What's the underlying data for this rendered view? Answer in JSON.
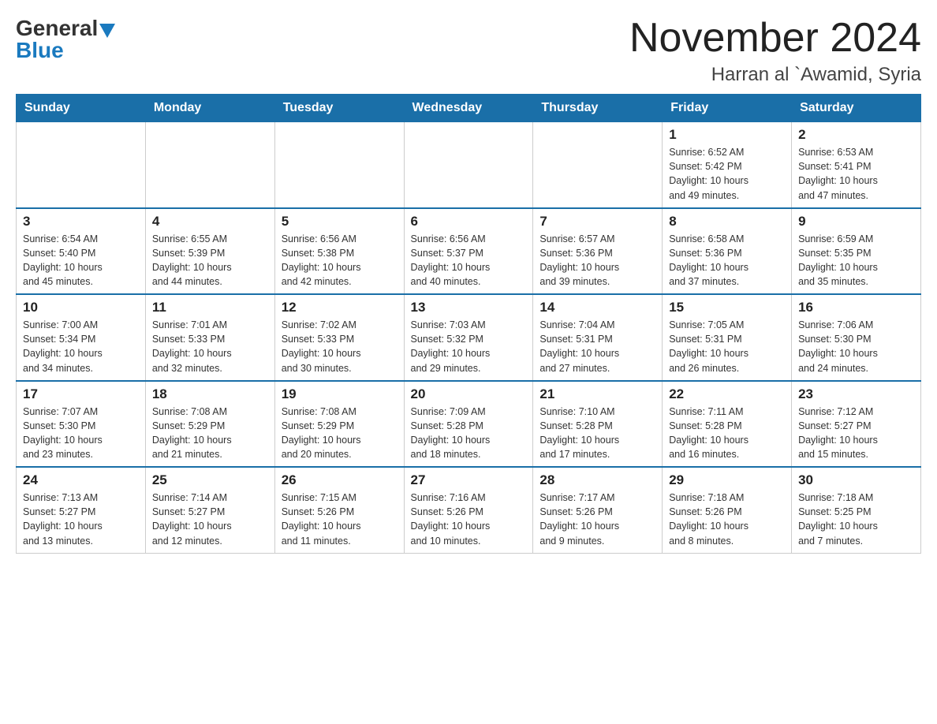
{
  "header": {
    "logo_text_general": "General",
    "logo_text_blue": "Blue",
    "month_year": "November 2024",
    "location": "Harran al `Awamid, Syria"
  },
  "weekdays": [
    "Sunday",
    "Monday",
    "Tuesday",
    "Wednesday",
    "Thursday",
    "Friday",
    "Saturday"
  ],
  "weeks": [
    [
      {
        "day": "",
        "info": ""
      },
      {
        "day": "",
        "info": ""
      },
      {
        "day": "",
        "info": ""
      },
      {
        "day": "",
        "info": ""
      },
      {
        "day": "",
        "info": ""
      },
      {
        "day": "1",
        "info": "Sunrise: 6:52 AM\nSunset: 5:42 PM\nDaylight: 10 hours\nand 49 minutes."
      },
      {
        "day": "2",
        "info": "Sunrise: 6:53 AM\nSunset: 5:41 PM\nDaylight: 10 hours\nand 47 minutes."
      }
    ],
    [
      {
        "day": "3",
        "info": "Sunrise: 6:54 AM\nSunset: 5:40 PM\nDaylight: 10 hours\nand 45 minutes."
      },
      {
        "day": "4",
        "info": "Sunrise: 6:55 AM\nSunset: 5:39 PM\nDaylight: 10 hours\nand 44 minutes."
      },
      {
        "day": "5",
        "info": "Sunrise: 6:56 AM\nSunset: 5:38 PM\nDaylight: 10 hours\nand 42 minutes."
      },
      {
        "day": "6",
        "info": "Sunrise: 6:56 AM\nSunset: 5:37 PM\nDaylight: 10 hours\nand 40 minutes."
      },
      {
        "day": "7",
        "info": "Sunrise: 6:57 AM\nSunset: 5:36 PM\nDaylight: 10 hours\nand 39 minutes."
      },
      {
        "day": "8",
        "info": "Sunrise: 6:58 AM\nSunset: 5:36 PM\nDaylight: 10 hours\nand 37 minutes."
      },
      {
        "day": "9",
        "info": "Sunrise: 6:59 AM\nSunset: 5:35 PM\nDaylight: 10 hours\nand 35 minutes."
      }
    ],
    [
      {
        "day": "10",
        "info": "Sunrise: 7:00 AM\nSunset: 5:34 PM\nDaylight: 10 hours\nand 34 minutes."
      },
      {
        "day": "11",
        "info": "Sunrise: 7:01 AM\nSunset: 5:33 PM\nDaylight: 10 hours\nand 32 minutes."
      },
      {
        "day": "12",
        "info": "Sunrise: 7:02 AM\nSunset: 5:33 PM\nDaylight: 10 hours\nand 30 minutes."
      },
      {
        "day": "13",
        "info": "Sunrise: 7:03 AM\nSunset: 5:32 PM\nDaylight: 10 hours\nand 29 minutes."
      },
      {
        "day": "14",
        "info": "Sunrise: 7:04 AM\nSunset: 5:31 PM\nDaylight: 10 hours\nand 27 minutes."
      },
      {
        "day": "15",
        "info": "Sunrise: 7:05 AM\nSunset: 5:31 PM\nDaylight: 10 hours\nand 26 minutes."
      },
      {
        "day": "16",
        "info": "Sunrise: 7:06 AM\nSunset: 5:30 PM\nDaylight: 10 hours\nand 24 minutes."
      }
    ],
    [
      {
        "day": "17",
        "info": "Sunrise: 7:07 AM\nSunset: 5:30 PM\nDaylight: 10 hours\nand 23 minutes."
      },
      {
        "day": "18",
        "info": "Sunrise: 7:08 AM\nSunset: 5:29 PM\nDaylight: 10 hours\nand 21 minutes."
      },
      {
        "day": "19",
        "info": "Sunrise: 7:08 AM\nSunset: 5:29 PM\nDaylight: 10 hours\nand 20 minutes."
      },
      {
        "day": "20",
        "info": "Sunrise: 7:09 AM\nSunset: 5:28 PM\nDaylight: 10 hours\nand 18 minutes."
      },
      {
        "day": "21",
        "info": "Sunrise: 7:10 AM\nSunset: 5:28 PM\nDaylight: 10 hours\nand 17 minutes."
      },
      {
        "day": "22",
        "info": "Sunrise: 7:11 AM\nSunset: 5:28 PM\nDaylight: 10 hours\nand 16 minutes."
      },
      {
        "day": "23",
        "info": "Sunrise: 7:12 AM\nSunset: 5:27 PM\nDaylight: 10 hours\nand 15 minutes."
      }
    ],
    [
      {
        "day": "24",
        "info": "Sunrise: 7:13 AM\nSunset: 5:27 PM\nDaylight: 10 hours\nand 13 minutes."
      },
      {
        "day": "25",
        "info": "Sunrise: 7:14 AM\nSunset: 5:27 PM\nDaylight: 10 hours\nand 12 minutes."
      },
      {
        "day": "26",
        "info": "Sunrise: 7:15 AM\nSunset: 5:26 PM\nDaylight: 10 hours\nand 11 minutes."
      },
      {
        "day": "27",
        "info": "Sunrise: 7:16 AM\nSunset: 5:26 PM\nDaylight: 10 hours\nand 10 minutes."
      },
      {
        "day": "28",
        "info": "Sunrise: 7:17 AM\nSunset: 5:26 PM\nDaylight: 10 hours\nand 9 minutes."
      },
      {
        "day": "29",
        "info": "Sunrise: 7:18 AM\nSunset: 5:26 PM\nDaylight: 10 hours\nand 8 minutes."
      },
      {
        "day": "30",
        "info": "Sunrise: 7:18 AM\nSunset: 5:25 PM\nDaylight: 10 hours\nand 7 minutes."
      }
    ]
  ]
}
